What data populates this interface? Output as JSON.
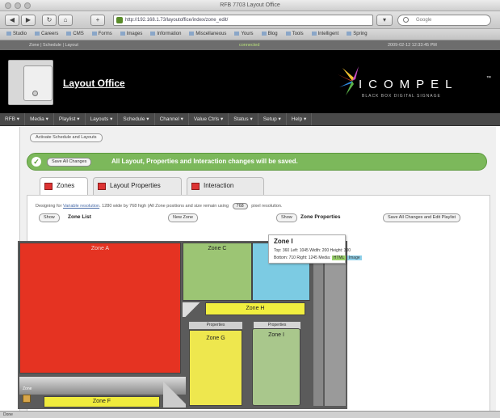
{
  "window": {
    "title": "RFB 7703 Layout Office"
  },
  "toolbar": {
    "back": "◀",
    "forward": "▶",
    "reload": "↻",
    "home": "⌂",
    "add": "+",
    "url": "http://192.168.1.73/layoutoffice/index/zone_edit/",
    "search_placeholder": "Google"
  },
  "bookmarks": [
    "Studio",
    "Careers",
    "CMS",
    "Forms",
    "Images",
    "Information",
    "Miscellaneous",
    "Yours",
    "Blog",
    "Tools",
    "Intelligent",
    "Spring"
  ],
  "status_strip": {
    "left": "Zone | Schedule | Layout",
    "middle": "connected",
    "right": "2009-02-12 12:33:45 PM"
  },
  "app": {
    "title": "Layout Office",
    "logo_text": "ICOMPEL",
    "logo_tm": "™",
    "logo_tagline": "BLACK BOX DIGITAL SIGNAGE"
  },
  "menu": [
    "RFB ▾",
    "Media ▾",
    "Playlist ▾",
    "Layouts ▾",
    "Schedule ▾",
    "Channel ▾",
    "Value Ctrls ▾",
    "Status ▾",
    "Setup ▾",
    "Help ▾"
  ],
  "subtoolbar": {
    "button": "Activate Schedule and Layouts"
  },
  "banner": {
    "button": "Save All Changes",
    "text": "All Layout, Properties and Interaction changes will be saved."
  },
  "tabs": [
    {
      "label": "Zones"
    },
    {
      "label": "Layout Properties"
    },
    {
      "label": "Interaction"
    }
  ],
  "panel": {
    "desc_prefix": "Designing for",
    "desc_link": "Variable resolution",
    "desc_mid": ". 1280 wide by 768 high (All Zone positions and size remain using",
    "desc_res": "768",
    "desc_suffix": "pixel resolution.",
    "show_button_1": "Show",
    "zone_list_label": "Zone List",
    "new_zone_button": "New Zone",
    "show_button_2": "Show",
    "zone_props_label": "Zone Properties",
    "save_all_button": "Save All Changes and Edit Playlist"
  },
  "zones": {
    "a": "Zone A",
    "c": "Zone C",
    "h": "Zone H",
    "g": "Zone G",
    "i": "Zone I",
    "f": "Zone F",
    "strip_g": "Properties",
    "strip_i": "Properties",
    "bottom_label": "Zone"
  },
  "properties": {
    "title": "Zone I",
    "row1": "Top: 360  Left: 1045  Width: 200  Height: 300",
    "row2_prefix": "Bottom: 710  Right: 1245  Media:",
    "row2_green": "HTML",
    "row2_blue": "Image"
  },
  "statusbar": {
    "text": "Done"
  }
}
